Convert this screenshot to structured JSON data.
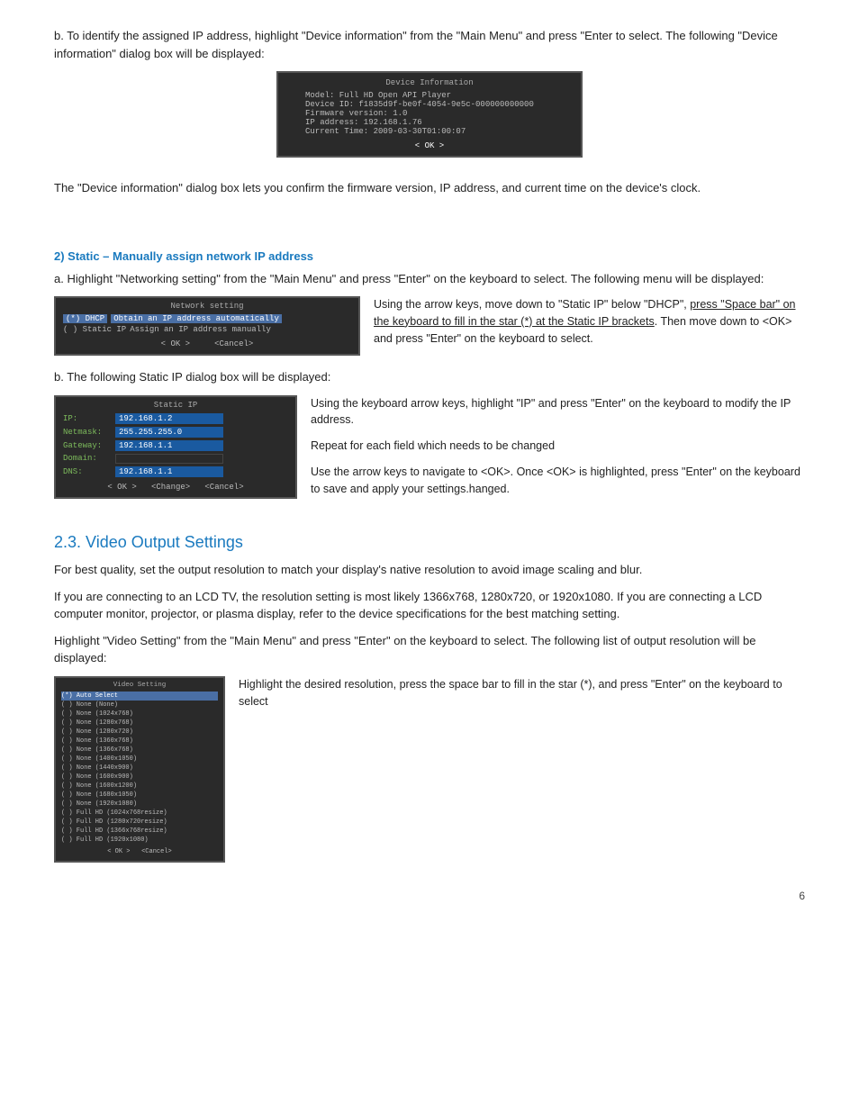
{
  "page": {
    "number": "6"
  },
  "section_b_intro": "b. To identify the assigned IP address, highlight \"Device information\" from the \"Main Menu\" and press \"Enter to select.   The following \"Device information\" dialog box will be displayed:",
  "device_info_dialog": {
    "title": "Device Information",
    "model": "Model: Full HD Open API Player",
    "device_id": "Device ID: f1835d9f-be0f-4054-9e5c-000000000000",
    "firmware": "Firmware version: 1.0",
    "ip": "IP address: 192.168.1.76",
    "time": "Current Time: 2009-03-30T01:00:07",
    "ok_btn": "< OK >"
  },
  "device_info_desc": "The \"Device information\" dialog box lets you confirm the firmware version, IP address, and current time on the device's clock.",
  "section2_heading": "2) Static – Manually assign network IP address",
  "section2a_intro": "a. Highlight \"Networking setting\" from the \"Main Menu\" and press \"Enter\" on the keyboard to select. The following menu will be displayed:",
  "network_setting_dialog": {
    "title": "Network setting",
    "row1_left": "(*) DHCP",
    "row1_right": "Obtain an IP address automatically",
    "row2_left": "( ) Static IP",
    "row2_right": "Assign an IP address manually",
    "ok_btn": "< OK >",
    "cancel_btn": "<Cancel>"
  },
  "network_setting_desc": "Using the arrow keys, move down to \"Static IP\" below \"DHCP\", press \"Space bar\" on the keyboard to fill in the star (*) at the Static IP brackets. Then move down to <OK> and press \"Enter\" on the keyboard to select.",
  "section2b_intro": "b. The following Static IP dialog box will be displayed:",
  "static_ip_dialog": {
    "title": "Static IP",
    "ip_label": "IP:",
    "ip_value": "192.168.1.2",
    "netmask_label": "Netmask:",
    "netmask_value": "255.255.255.0",
    "gateway_label": "Gateway:",
    "gateway_value": "192.168.1.1",
    "domain_label": "Domain:",
    "domain_value": "",
    "dns_label": "DNS:",
    "dns_value": "192.168.1.1",
    "ok_btn": "< OK >",
    "change_btn": "<Change>",
    "cancel_btn": "<Cancel>"
  },
  "static_ip_desc1": "Using the keyboard arrow keys, highlight \"IP\" and press \"Enter\" on the keyboard to modify the IP address.",
  "static_ip_desc2": "Repeat for each field which needs to be changed",
  "static_ip_desc3": "Use the arrow keys to navigate to <OK>. Once <OK> is highlighted, press \"Enter\" on the keyboard to save and apply your settings.hanged.",
  "section23_heading_num": "2.3.",
  "section23_heading_text": "Video Output Settings",
  "video_para1": "For best quality, set the output resolution to match your display's native resolution to avoid image scaling and blur.",
  "video_para2": "If you are connecting to an LCD TV, the resolution setting is most likely 1366x768, 1280x720, or 1920x1080. If you are connecting a LCD computer monitor, projector, or plasma display, refer to the device specifications for the best matching setting.",
  "video_para3": "Highlight \"Video Setting\" from the \"Main Menu\" and press \"Enter\" on the keyboard to select. The following list of output resolution will be displayed:",
  "video_output_dialog": {
    "title": "Video Setting",
    "rows": [
      {
        "label": "(*) Auto Select"
      },
      {
        "label": "( ) None (None)"
      },
      {
        "label": "( ) None (1024x768)"
      },
      {
        "label": "( ) None (1280x768)"
      },
      {
        "label": "( ) None (1280x720)"
      },
      {
        "label": "( ) None (1360x768)"
      },
      {
        "label": "( ) None (1366x768)"
      },
      {
        "label": "( ) None (1400x1050)"
      },
      {
        "label": "( ) None (1440x900)"
      },
      {
        "label": "( ) None (1600x900)"
      },
      {
        "label": "( ) None (1600x1200)"
      },
      {
        "label": "( ) None (1680x1050)"
      },
      {
        "label": "( ) None (1920x1080)"
      },
      {
        "label": "( ) Full HD (1024x768resize)"
      },
      {
        "label": "( ) Full HD (1280x720resize)"
      },
      {
        "label": "( ) Full HD (1366x768resize)"
      },
      {
        "label": "( ) Full HD (1920x1080)"
      }
    ],
    "ok_btn": "< OK >",
    "cancel_btn": "<Cancel>"
  },
  "video_desc": "Highlight the desired resolution, press the space bar to fill in the star (*), and press \"Enter\" on the keyboard to select"
}
